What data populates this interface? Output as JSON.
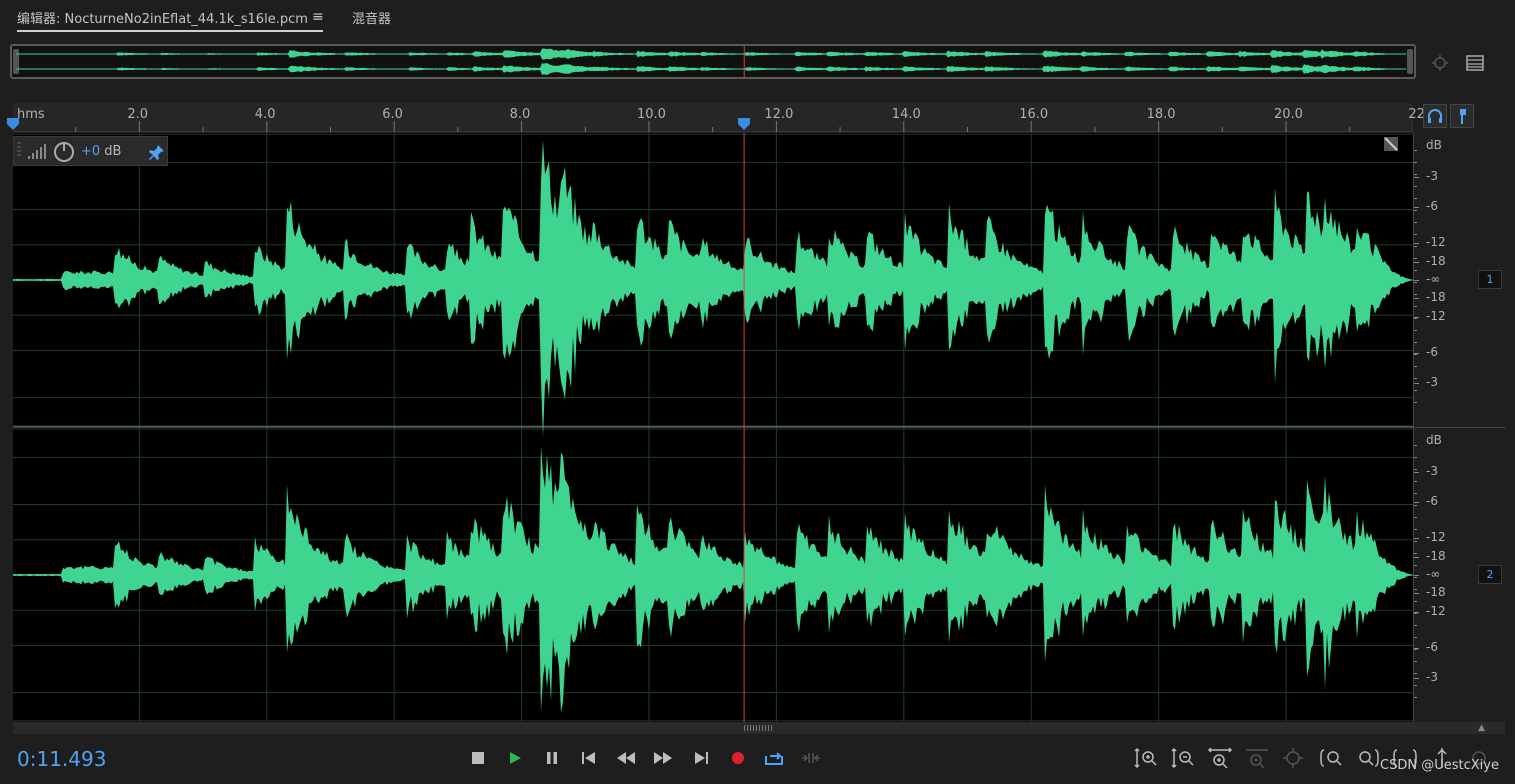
{
  "tabs": {
    "editor": "编辑器: NocturneNo2inEflat_44.1k_s16le.pcm",
    "mixer": "混音器"
  },
  "ruler": {
    "unit_label": "hms",
    "ticks": [
      "2.0",
      "4.0",
      "6.0",
      "8.0",
      "10.0",
      "12.0",
      "14.0",
      "16.0",
      "18.0",
      "20.0",
      "22"
    ]
  },
  "hud": {
    "gain_value": "+0",
    "gain_unit": " dB"
  },
  "db_scale": {
    "channel1": {
      "header": "dB",
      "labels": [
        "-3",
        "-6",
        "-12",
        "-18",
        "-∞",
        "-18",
        "-12",
        "-6",
        "-3"
      ],
      "badge": "1"
    },
    "channel2": {
      "header": "dB",
      "labels": [
        "-3",
        "-6",
        "-12",
        "-18",
        "-∞",
        "-18",
        "-12",
        "-6",
        "-3"
      ],
      "badge": "2"
    }
  },
  "transport": {
    "timecode": "0:11.493",
    "playhead_seconds": 11.493,
    "timeline_end_seconds": 22
  },
  "colors": {
    "waveform": "#3fd490",
    "playhead": "#e23b3b",
    "accent": "#4ea3f5",
    "record": "#e0202a",
    "play": "#2db84b"
  },
  "icons": {
    "stop": "stop-icon",
    "play": "play-icon",
    "pause": "pause-icon",
    "to_start": "skip-to-start-icon",
    "rewind": "rewind-icon",
    "forward": "fast-forward-icon",
    "to_end": "skip-to-end-icon",
    "record": "record-icon",
    "loop": "loop-icon",
    "skip": "skip-selection-icon"
  },
  "watermark": "CSDN @UestcXiye"
}
